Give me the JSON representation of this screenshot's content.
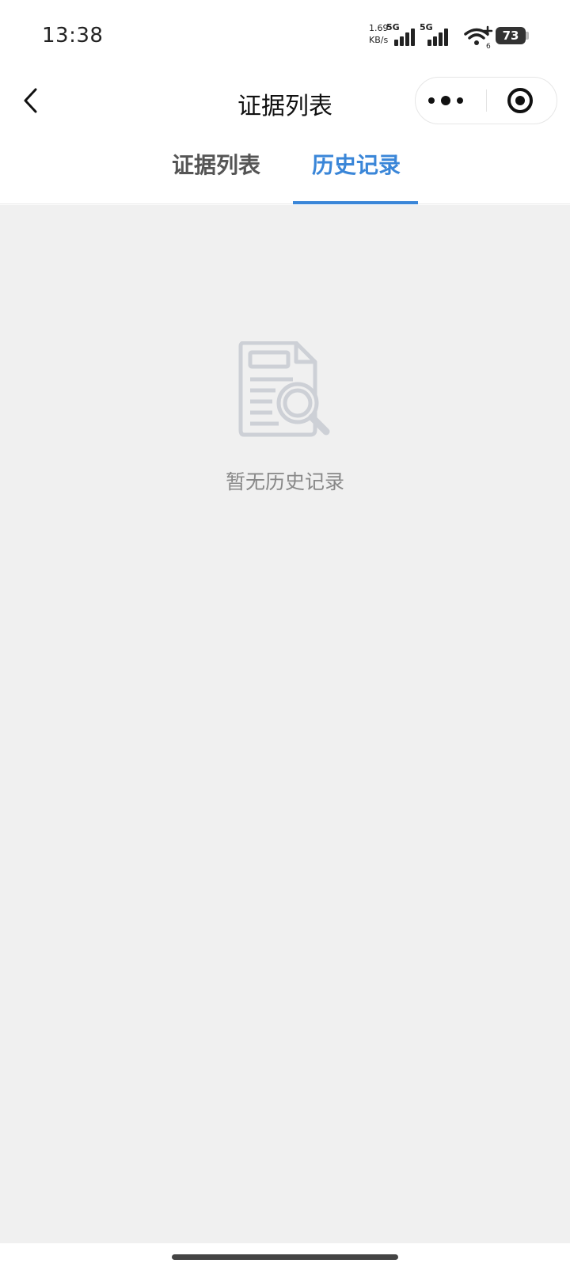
{
  "status_bar": {
    "time": "13:38",
    "net_speed_value": "1.69",
    "net_speed_unit": "KB/s",
    "sim1_label": "5G",
    "sim2_label": "5G",
    "wifi_badge": "6",
    "battery": "73"
  },
  "nav": {
    "title": "证据列表"
  },
  "tabs": [
    {
      "label": "证据列表",
      "active": false
    },
    {
      "label": "历史记录",
      "active": true
    }
  ],
  "empty_state": {
    "icon": "document-search-icon",
    "message": "暂无历史记录"
  },
  "colors": {
    "accent": "#3a86d8",
    "background": "#f0f0f0",
    "muted_text": "#888888"
  }
}
